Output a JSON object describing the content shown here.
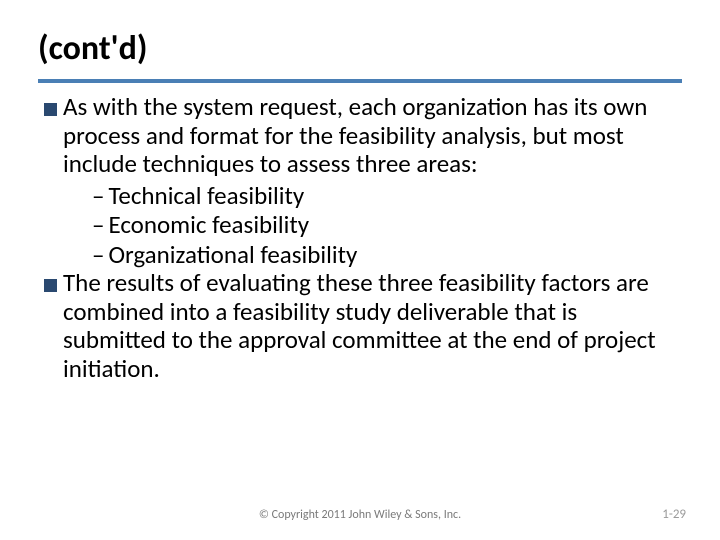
{
  "title": "(cont'd)",
  "bullets": [
    {
      "text": "As with the system request, each organization has its own process and format for the feasibility analysis, but most include techniques to assess three areas:",
      "subitems": [
        "Technical feasibility",
        "Economic feasibility",
        "Organizational feasibility"
      ]
    },
    {
      "text": "The results of evaluating these three feasibility factors are combined into a feasibility study deliverable that is submitted to the approval committee at the end of project initiation.",
      "subitems": []
    }
  ],
  "footer": {
    "copyright": "© Copyright 2011 John Wiley & Sons, Inc.",
    "page": "1-29"
  }
}
